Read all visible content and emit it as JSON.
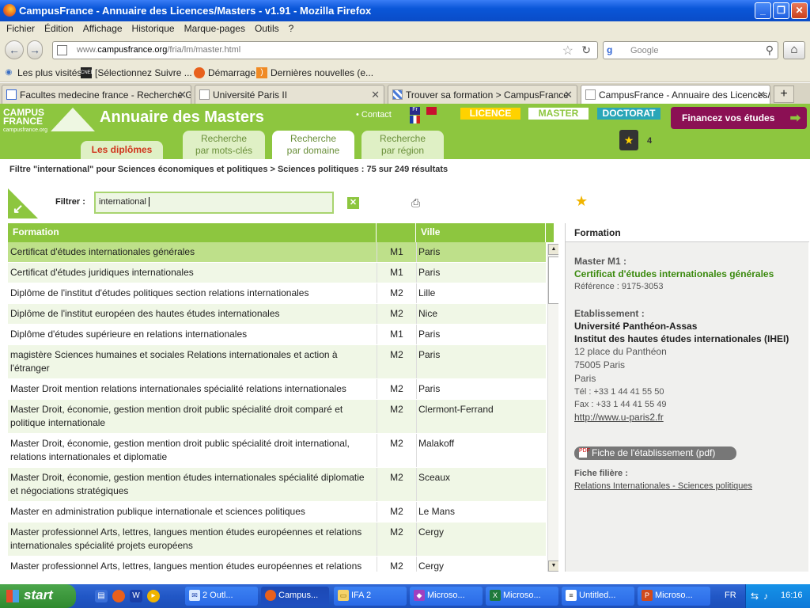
{
  "window": {
    "title": "CampusFrance - Annuaire des Licences/Masters - v1.91 - Mozilla Firefox"
  },
  "menu": [
    "Fichier",
    "Édition",
    "Affichage",
    "Historique",
    "Marque-pages",
    "Outils",
    "?"
  ],
  "nav": {
    "url_prefix": "www.",
    "url_domain": "campusfrance.org",
    "url_path": "/fria/lm/master.html",
    "search_placeholder": "Google"
  },
  "bookmarks": [
    "Les plus visités",
    "[Sélectionnez Suivre ...",
    "Démarrage",
    "Dernières nouvelles (e..."
  ],
  "bookmark_icons": {
    "b1": "CNED"
  },
  "tabs": [
    {
      "label": "Facultes medecine france - Recherche G..."
    },
    {
      "label": "Université Paris II"
    },
    {
      "label": "Trouver sa formation > CampusFrance"
    },
    {
      "label": "CampusFrance - Annuaire des Licences/..."
    }
  ],
  "site": {
    "logo_line1": "CAMPUS",
    "logo_line2": "FRANCE",
    "logo_small": "campusfrance.org",
    "title": "Annuaire des Masters",
    "contact": "• Contact",
    "flag_fr": "Fr",
    "levels": [
      "LICENCE",
      "MASTER",
      "DOCTORAT"
    ],
    "finance": "Financez vos études",
    "cart_count": "4",
    "tabs": [
      {
        "line1": "Les diplômes",
        "line2": ""
      },
      {
        "line1": "Recherche",
        "line2": "par mots-clés"
      },
      {
        "line1": "Recherche",
        "line2": "par domaine"
      },
      {
        "line1": "Recherche",
        "line2": "par région"
      }
    ]
  },
  "breadcrumb": "Filtre \"international\" pour Sciences économiques et politiques > Sciences politiques : 75 sur 249 résultats",
  "filter": {
    "label": "Filtrer :",
    "value": "international"
  },
  "table": {
    "headers": [
      "Formation",
      "",
      "Ville"
    ],
    "rows": [
      {
        "formation": "Certificat d'études internationales générales",
        "niveau": "M1",
        "ville": "Paris"
      },
      {
        "formation": "Certificat d'études juridiques internationales",
        "niveau": "M1",
        "ville": "Paris"
      },
      {
        "formation": "Diplôme de l'institut d'études politiques section relations internationales",
        "niveau": "M2",
        "ville": "Lille"
      },
      {
        "formation": "Diplôme de l'institut européen des hautes études internationales",
        "niveau": "M2",
        "ville": "Nice"
      },
      {
        "formation": "Diplôme d'études supérieure en relations internationales",
        "niveau": "M1",
        "ville": "Paris"
      },
      {
        "formation": "magistère Sciences humaines et sociales Relations internationales et action à l'étranger",
        "niveau": "M2",
        "ville": "Paris"
      },
      {
        "formation": "Master Droit mention relations internationales spécialité relations internationales",
        "niveau": "M2",
        "ville": "Paris"
      },
      {
        "formation": "Master Droit, économie, gestion mention droit public spécialité droit comparé et politique internationale",
        "niveau": "M2",
        "ville": "Clermont-Ferrand"
      },
      {
        "formation": "Master Droit, économie, gestion mention droit public spécialité droit international, relations internationales et diplomatie",
        "niveau": "M2",
        "ville": "Malakoff"
      },
      {
        "formation": "Master Droit, économie, gestion mention études internationales spécialité diplomatie et négociations stratégiques",
        "niveau": "M2",
        "ville": "Sceaux"
      },
      {
        "formation": "Master en administration publique internationale et sciences politiques",
        "niveau": "M2",
        "ville": "Le Mans"
      },
      {
        "formation": "Master professionnel Arts, lettres, langues mention études européennes et relations internationales spécialité projets européens",
        "niveau": "M2",
        "ville": "Cergy"
      },
      {
        "formation": "Master professionnel Arts, lettres, langues mention études européennes et relations internationales spécialité relations internationales et actions à l'étranger",
        "niveau": "M2",
        "ville": "Cergy"
      }
    ]
  },
  "detail": {
    "header": "Formation",
    "level_label": "Master M1 :",
    "title": "Certificat d'études internationales générales",
    "reference": "Référence : 9175-3053",
    "etab_label": "Etablissement :",
    "etab_name": "Université Panthéon-Assas",
    "etab_institute": "Institut des hautes études internationales (IHEI)",
    "address1": "12 place du Panthéon",
    "address2": "75005 Paris",
    "address3": "Paris",
    "tel": "Tél : +33 1 44 41 55 50",
    "fax": "Fax : +33 1 44 41 55 49",
    "web": "http://www.u-paris2.fr",
    "pdf_button": "Fiche de l'établissement (pdf)",
    "filiere_label": "Fiche filière :",
    "filiere_link": "Relations Internationales - Sciences politiques"
  },
  "taskbar": {
    "start": "start",
    "quicklaunch_word": "W",
    "tasks": [
      "2 Outl...",
      "Campus...",
      "IFA 2",
      "Microso...",
      "Microso...",
      "Untitled...",
      "Microso..."
    ],
    "lang": "FR",
    "clock": "16:16"
  }
}
